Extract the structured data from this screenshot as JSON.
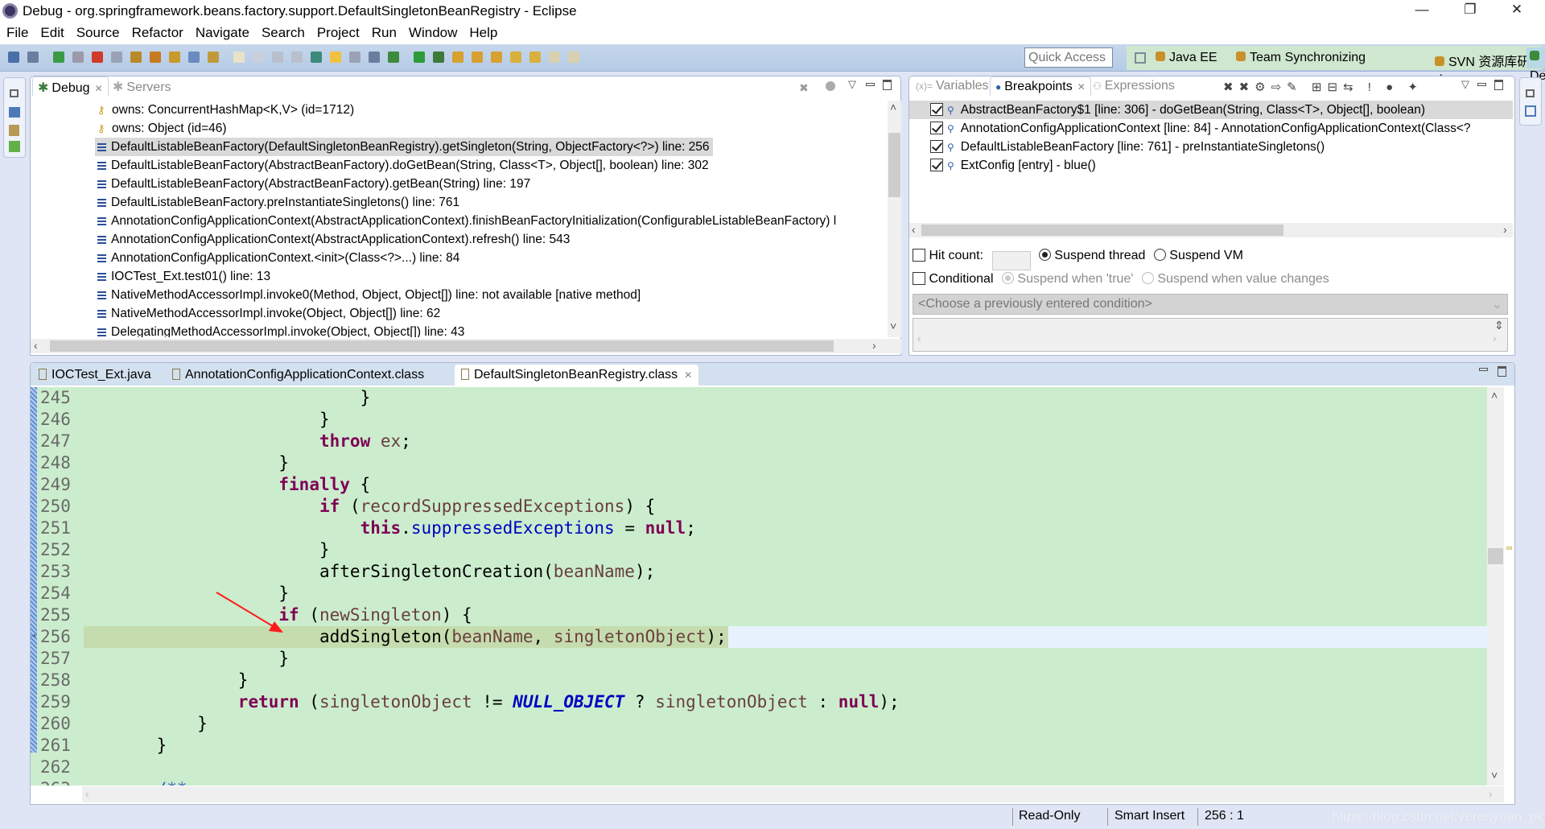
{
  "window": {
    "title": "Debug - org.springframework.beans.factory.support.DefaultSingletonBeanRegistry - Eclipse",
    "minimize": "—",
    "restore": "❐",
    "close": "✕"
  },
  "menu": [
    "File",
    "Edit",
    "Source",
    "Refactor",
    "Navigate",
    "Search",
    "Project",
    "Run",
    "Window",
    "Help"
  ],
  "toolbar": {
    "icons": [
      "display-icon",
      "skip-breakpoints-icon",
      "resume-icon",
      "suspend-icon",
      "terminate-icon",
      "disconnect-icon",
      "step-into-icon",
      "step-over-icon",
      "step-return-icon",
      "drop-to-frame-icon",
      "use-step-filters-icon",
      "new-icon",
      "new-class-icon",
      "save-icon",
      "save-all-icon",
      "open-type-icon",
      "toggle-mark-occurrences-icon",
      "toggle-whitespace-icon",
      "show-whitespace-icon",
      "debug-icon",
      "run-icon",
      "external-tools-icon",
      "open-folder-icon",
      "open-task-icon",
      "search-icon",
      "next-annotation-icon",
      "prev-annotation-icon",
      "back-icon",
      "forward-icon"
    ],
    "quick_access": "Quick Access",
    "perspectives": [
      {
        "label": "Java EE",
        "icon": "java-ee-icon"
      },
      {
        "label": "Team Synchronizing",
        "icon": "team-sync-icon"
      },
      {
        "label": "SVN 资源库研究",
        "icon": "svn-icon"
      },
      {
        "label": "Debug",
        "icon": "debug-perspective-icon",
        "active": true
      }
    ]
  },
  "debug_view": {
    "tabs": [
      {
        "label": "Debug",
        "active": true
      },
      {
        "label": "Servers",
        "active": false
      }
    ],
    "items": [
      {
        "type": "monitor",
        "label": "owns: ConcurrentHashMap<K,V>  (id=1712)"
      },
      {
        "type": "monitor",
        "label": "owns: Object  (id=46)"
      },
      {
        "type": "frame",
        "label": "DefaultListableBeanFactory(DefaultSingletonBeanRegistry).getSingleton(String, ObjectFactory<?>) line: 256",
        "selected": true
      },
      {
        "type": "frame",
        "label": "DefaultListableBeanFactory(AbstractBeanFactory).doGetBean(String, Class<T>, Object[], boolean) line: 302"
      },
      {
        "type": "frame",
        "label": "DefaultListableBeanFactory(AbstractBeanFactory).getBean(String) line: 197"
      },
      {
        "type": "frame",
        "label": "DefaultListableBeanFactory.preInstantiateSingletons() line: 761"
      },
      {
        "type": "frame",
        "label": "AnnotationConfigApplicationContext(AbstractApplicationContext).finishBeanFactoryInitialization(ConfigurableListableBeanFactory) l"
      },
      {
        "type": "frame",
        "label": "AnnotationConfigApplicationContext(AbstractApplicationContext).refresh() line: 543"
      },
      {
        "type": "frame",
        "label": "AnnotationConfigApplicationContext.<init>(Class<?>...) line: 84"
      },
      {
        "type": "frame",
        "label": "IOCTest_Ext.test01() line: 13"
      },
      {
        "type": "frame",
        "label": "NativeMethodAccessorImpl.invoke0(Method, Object, Object[]) line: not available [native method]"
      },
      {
        "type": "frame",
        "label": "NativeMethodAccessorImpl.invoke(Object, Object[]) line: 62"
      },
      {
        "type": "frame",
        "label": "DelegatingMethodAccessorImpl.invoke(Object, Object[]) line: 43"
      }
    ]
  },
  "breakpoints_view": {
    "tabs": [
      {
        "label": "Variables",
        "active": false
      },
      {
        "label": "Breakpoints",
        "active": true
      },
      {
        "label": "Expressions",
        "active": false
      }
    ],
    "items": [
      {
        "checked": true,
        "label": "AbstractBeanFactory$1 [line: 306] - doGetBean(String, Class<T>, Object[], boolean)",
        "selected": true
      },
      {
        "checked": true,
        "label": "AnnotationConfigApplicationContext [line: 84] - AnnotationConfigApplicationContext(Class<?"
      },
      {
        "checked": true,
        "label": "DefaultListableBeanFactory [line: 761] - preInstantiateSingletons()"
      },
      {
        "checked": true,
        "label": "ExtConfig [entry] - blue()"
      }
    ],
    "hit_count_label": "Hit count:",
    "hit_count_value": "",
    "suspend_thread": "Suspend thread",
    "suspend_vm": "Suspend VM",
    "conditional_label": "Conditional",
    "suspend_when_true": "Suspend when 'true'",
    "suspend_when_changes": "Suspend when value changes",
    "condition_placeholder": "<Choose a previously entered condition>"
  },
  "editor": {
    "tabs": [
      {
        "label": "IOCTest_Ext.java",
        "active": false
      },
      {
        "label": "AnnotationConfigApplicationContext.class",
        "active": false
      },
      {
        "label": "DefaultSingletonBeanRegistry.class",
        "active": true
      }
    ],
    "current_line": 256,
    "lines": [
      {
        "n": "245",
        "indent": 24,
        "tokens": [
          {
            "t": "}"
          }
        ]
      },
      {
        "n": "246",
        "indent": 20,
        "tokens": [
          {
            "t": "}"
          }
        ]
      },
      {
        "n": "247",
        "indent": 20,
        "tokens": [
          {
            "t": "throw",
            "c": "kw"
          },
          {
            "t": " "
          },
          {
            "t": "ex",
            "c": "loc"
          },
          {
            "t": ";"
          }
        ]
      },
      {
        "n": "248",
        "indent": 16,
        "tokens": [
          {
            "t": "}"
          }
        ]
      },
      {
        "n": "249",
        "indent": 16,
        "tokens": [
          {
            "t": "finally",
            "c": "kw"
          },
          {
            "t": " {"
          }
        ]
      },
      {
        "n": "250",
        "indent": 20,
        "tokens": [
          {
            "t": "if",
            "c": "kw"
          },
          {
            "t": " ("
          },
          {
            "t": "recordSuppressedExceptions",
            "c": "loc"
          },
          {
            "t": ") {"
          }
        ]
      },
      {
        "n": "251",
        "indent": 24,
        "tokens": [
          {
            "t": "this",
            "c": "kw"
          },
          {
            "t": "."
          },
          {
            "t": "suppressedExceptions",
            "c": "fld"
          },
          {
            "t": " = "
          },
          {
            "t": "null",
            "c": "kw"
          },
          {
            "t": ";"
          }
        ]
      },
      {
        "n": "252",
        "indent": 20,
        "tokens": [
          {
            "t": "}"
          }
        ]
      },
      {
        "n": "253",
        "indent": 20,
        "tokens": [
          {
            "t": "afterSingletonCreation("
          },
          {
            "t": "beanName",
            "c": "loc"
          },
          {
            "t": ");"
          }
        ]
      },
      {
        "n": "254",
        "indent": 16,
        "tokens": [
          {
            "t": "}"
          }
        ]
      },
      {
        "n": "255",
        "indent": 16,
        "tokens": [
          {
            "t": "if",
            "c": "kw"
          },
          {
            "t": " ("
          },
          {
            "t": "newSingleton",
            "c": "loc"
          },
          {
            "t": ") {"
          }
        ]
      },
      {
        "n": "256",
        "indent": 20,
        "tokens": [
          {
            "t": "addSingleton("
          },
          {
            "t": "beanName",
            "c": "loc"
          },
          {
            "t": ", "
          },
          {
            "t": "singletonObject",
            "c": "loc"
          },
          {
            "t": ");"
          }
        ]
      },
      {
        "n": "257",
        "indent": 16,
        "tokens": [
          {
            "t": "}"
          }
        ]
      },
      {
        "n": "258",
        "indent": 12,
        "tokens": [
          {
            "t": "}"
          }
        ]
      },
      {
        "n": "259",
        "indent": 12,
        "tokens": [
          {
            "t": "return",
            "c": "kw"
          },
          {
            "t": " ("
          },
          {
            "t": "singletonObject",
            "c": "loc"
          },
          {
            "t": " != "
          },
          {
            "t": "NULL_OBJECT",
            "c": "const"
          },
          {
            "t": " ? "
          },
          {
            "t": "singletonObject",
            "c": "loc"
          },
          {
            "t": " : "
          },
          {
            "t": "null",
            "c": "kw"
          },
          {
            "t": ");"
          }
        ]
      },
      {
        "n": "260",
        "indent": 8,
        "tokens": [
          {
            "t": "}"
          }
        ]
      },
      {
        "n": "261",
        "indent": 4,
        "tokens": [
          {
            "t": "}"
          }
        ]
      },
      {
        "n": "262",
        "indent": 0,
        "tokens": []
      },
      {
        "n": "263",
        "indent": 4,
        "tokens": [
          {
            "t": "/**",
            "c": "cmt"
          }
        ]
      }
    ]
  },
  "status": {
    "read_only": "Read-Only",
    "insert_mode": "Smart Insert",
    "position": "256 : 1"
  },
  "watermark": "https://blog.csdn.net/yerenyuan_pku",
  "colors": {
    "editor_bg": "#cbedcd",
    "current_line": "#c5dcae",
    "keyword": "#7f0055",
    "field": "#0000c0",
    "local": "#6a3e3e",
    "annotation_arrow": "#ff0000"
  }
}
